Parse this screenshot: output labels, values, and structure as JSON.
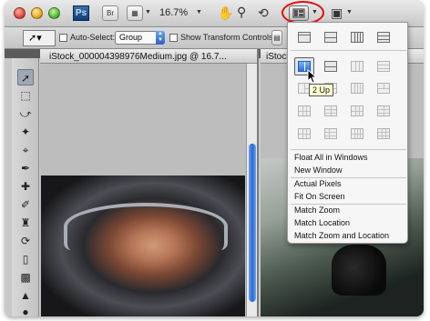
{
  "app": {
    "logo": "Ps",
    "bridge_label": "Br",
    "zoom_level": "16.7%"
  },
  "window_controls": [
    "close",
    "minimize",
    "zoom"
  ],
  "app_bar": {
    "icons": [
      "hand-icon",
      "zoom-tool-icon",
      "rotate-view-icon",
      "arrange-documents-icon",
      "screen-mode-icon"
    ]
  },
  "options_bar": {
    "auto_select_label": "Auto-Select:",
    "auto_select_value": "Group",
    "show_transform_label": "Show Transform Controls"
  },
  "documents": [
    {
      "title": "iStock_000004398976Medium.jpg @ 16.7..."
    },
    {
      "title": "iStock"
    }
  ],
  "arrange_menu": {
    "tooltip": "2 Up",
    "items": [
      "Float All in Windows",
      "New Window",
      "Actual Pixels",
      "Fit On Screen",
      "Match Zoom",
      "Match Location",
      "Match Zoom and Location"
    ]
  },
  "colors": {
    "highlight_ring": "#e01010",
    "selection_blue": "#2b67d4"
  }
}
